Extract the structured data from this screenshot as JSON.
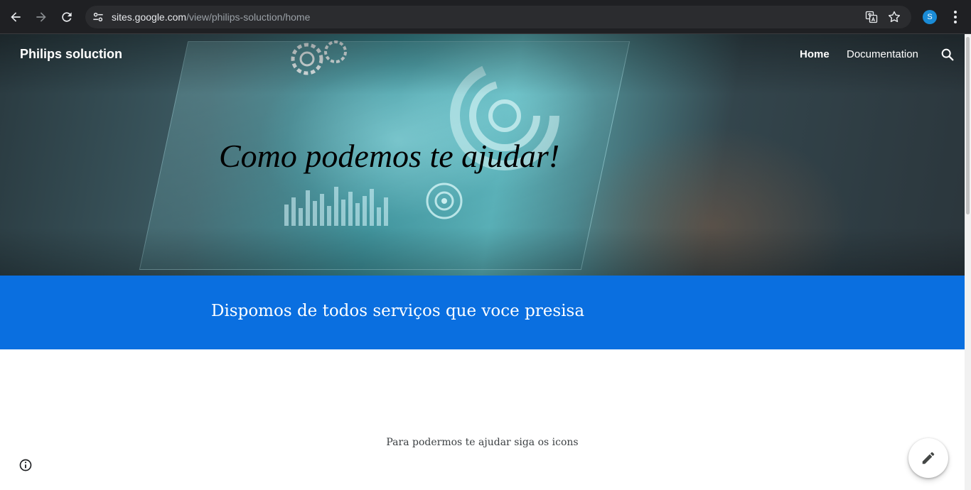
{
  "browser": {
    "url_host": "sites.google.com",
    "url_path": "/view/philips-soluction/home",
    "profile_initial": "S",
    "icons": [
      "back-icon",
      "forward-icon",
      "reload-icon",
      "site-info-icon",
      "translate-icon",
      "star-icon",
      "menu-icon"
    ]
  },
  "site": {
    "title": "Philips soluction",
    "nav": {
      "home": "Home",
      "documentation": "Documentation"
    }
  },
  "hero": {
    "heading": "Como podemos te ajudar!"
  },
  "banner": {
    "text": "Dispomos de todos serviços que voce presisa",
    "color": "#0a6fe0"
  },
  "content": {
    "paragraph": "Para podermos te ajudar siga os icons"
  }
}
